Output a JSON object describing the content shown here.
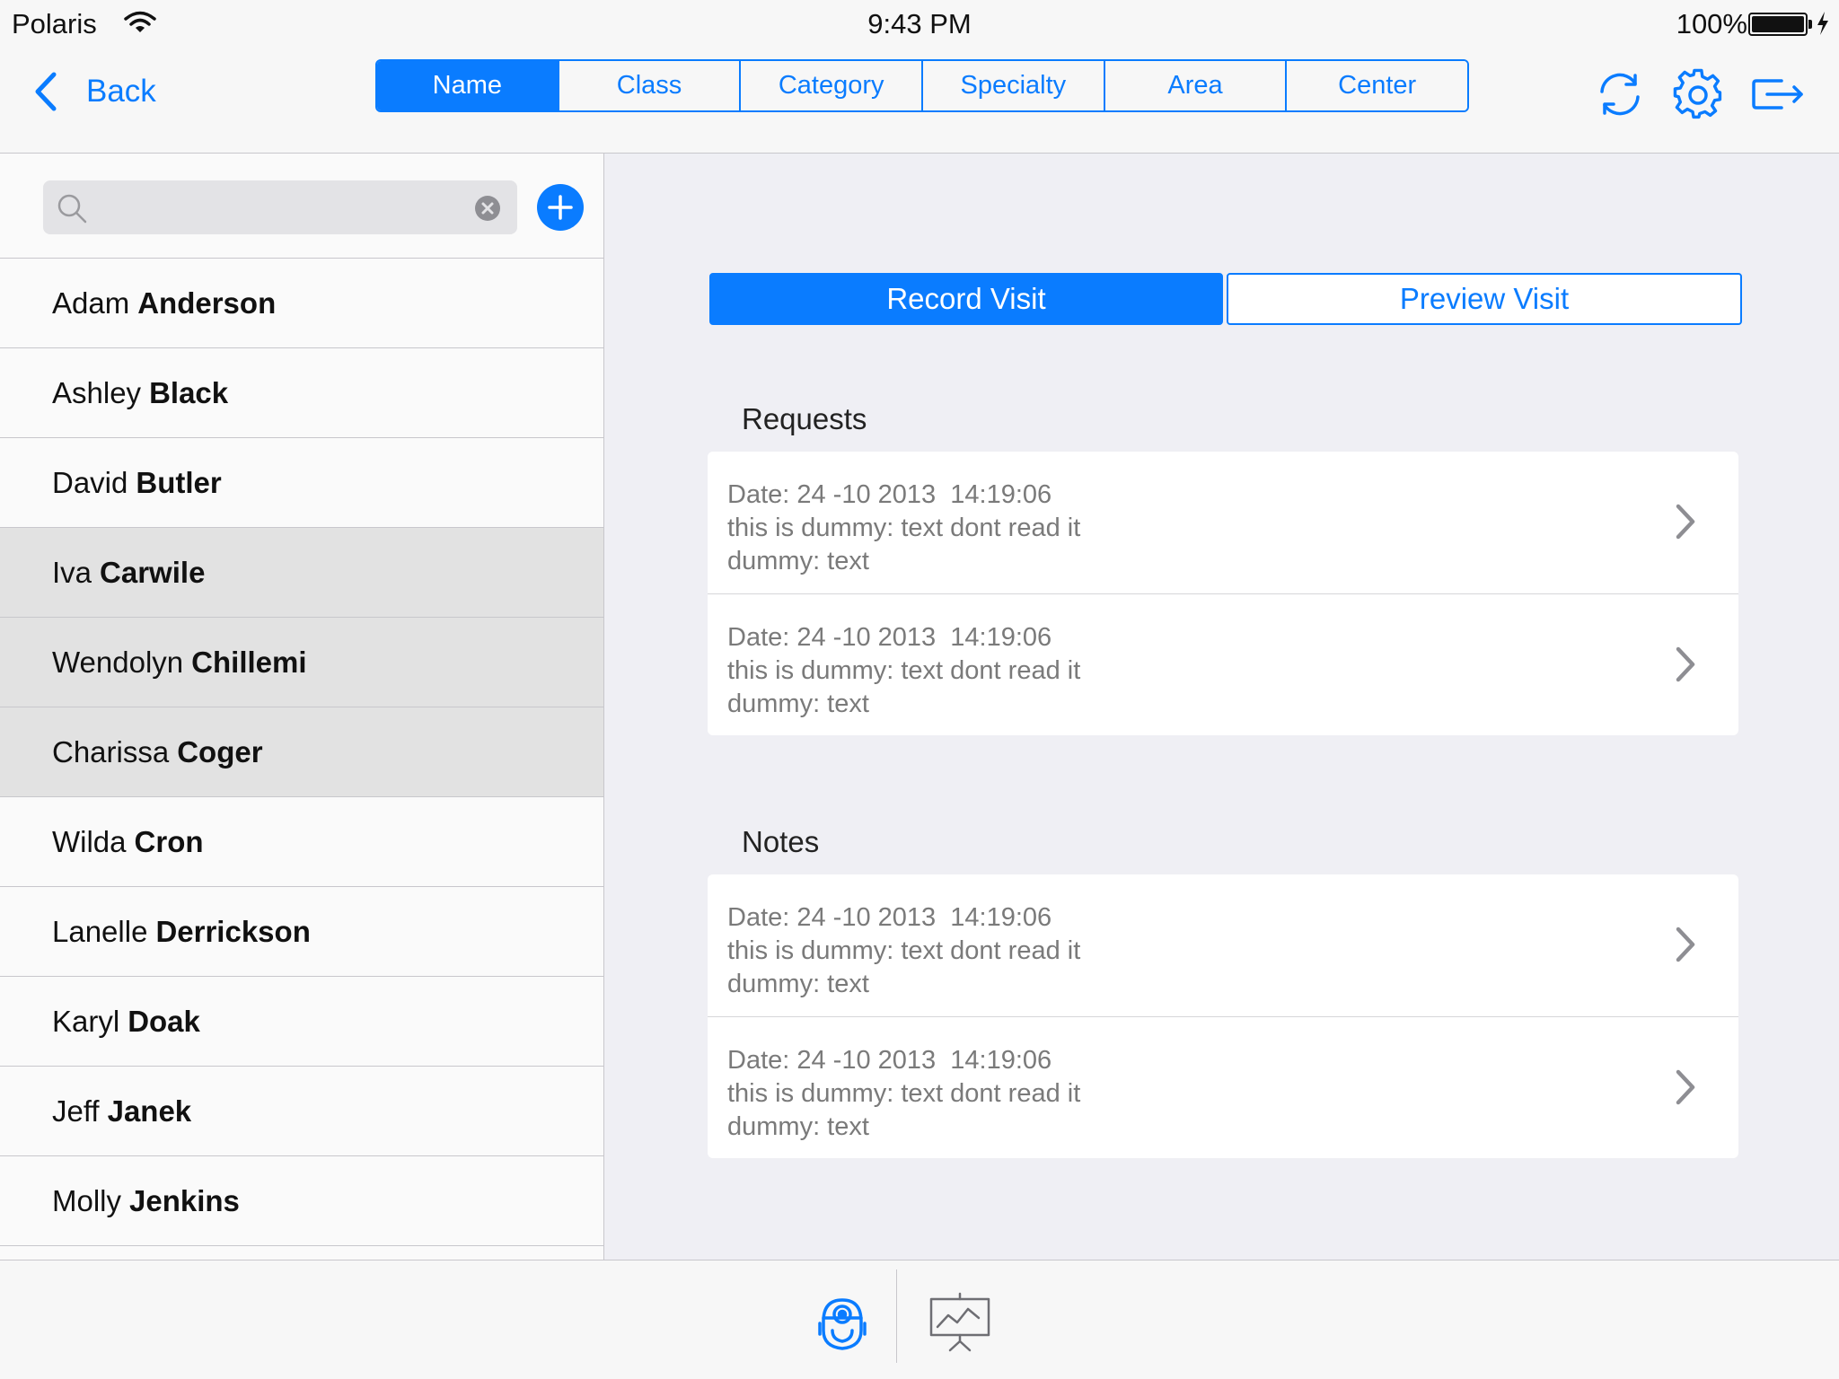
{
  "status_bar": {
    "carrier": "Polaris",
    "time": "9:43 PM",
    "battery": "100%",
    "icons": [
      "wifi-icon",
      "battery-icon",
      "charging-bolt-icon"
    ]
  },
  "nav": {
    "back_label": "Back",
    "tabs": [
      {
        "label": "Name",
        "active": true
      },
      {
        "label": "Class",
        "active": false
      },
      {
        "label": "Category",
        "active": false
      },
      {
        "label": "Specialty",
        "active": false
      },
      {
        "label": "Area",
        "active": false
      },
      {
        "label": "Center",
        "active": false
      }
    ],
    "icons": [
      "sync-icon",
      "gear-icon",
      "logout-icon"
    ]
  },
  "sidebar": {
    "search": {
      "value": "",
      "placeholder": ""
    },
    "people": [
      {
        "first": "Adam",
        "last": "Anderson",
        "highlighted": false
      },
      {
        "first": "Ashley",
        "last": "Black",
        "highlighted": false
      },
      {
        "first": "David",
        "last": "Butler",
        "highlighted": false
      },
      {
        "first": "Iva",
        "last": "Carwile",
        "highlighted": true
      },
      {
        "first": "Wendolyn",
        "last": "Chillemi",
        "highlighted": true
      },
      {
        "first": "Charissa",
        "last": "Coger",
        "highlighted": true
      },
      {
        "first": "Wilda",
        "last": "Cron",
        "highlighted": false
      },
      {
        "first": "Lanelle",
        "last": "Derrickson",
        "highlighted": false
      },
      {
        "first": "Karyl",
        "last": "Doak",
        "highlighted": false
      },
      {
        "first": "Jeff",
        "last": "Janek",
        "highlighted": false
      },
      {
        "first": "Molly",
        "last": "Jenkins",
        "highlighted": false
      }
    ]
  },
  "main": {
    "record_label": "Record Visit",
    "preview_label": "Preview Visit",
    "requests": {
      "title": "Requests",
      "entries": [
        {
          "date": "Date: 24 -10 2013  14:19:06",
          "text": "this is dummy: text dont read it",
          "sub": "dummy: text"
        },
        {
          "date": "Date: 24 -10 2013  14:19:06",
          "text": "this is dummy: text dont read it",
          "sub": "dummy: text"
        }
      ]
    },
    "notes": {
      "title": "Notes",
      "entries": [
        {
          "date": "Date: 24 -10 2013  14:19:06",
          "text": "this is dummy: text dont read it",
          "sub": "dummy: text"
        },
        {
          "date": "Date: 24 -10 2013  14:19:06",
          "text": "this is dummy: text dont read it",
          "sub": "dummy: text"
        }
      ]
    }
  },
  "tab_bar": {
    "icons": [
      "doctor-icon",
      "presentation-icon"
    ]
  },
  "colors": {
    "accent": "#0a7cff",
    "highlight_row": "#e2e2e2",
    "background": "#efeff4"
  }
}
